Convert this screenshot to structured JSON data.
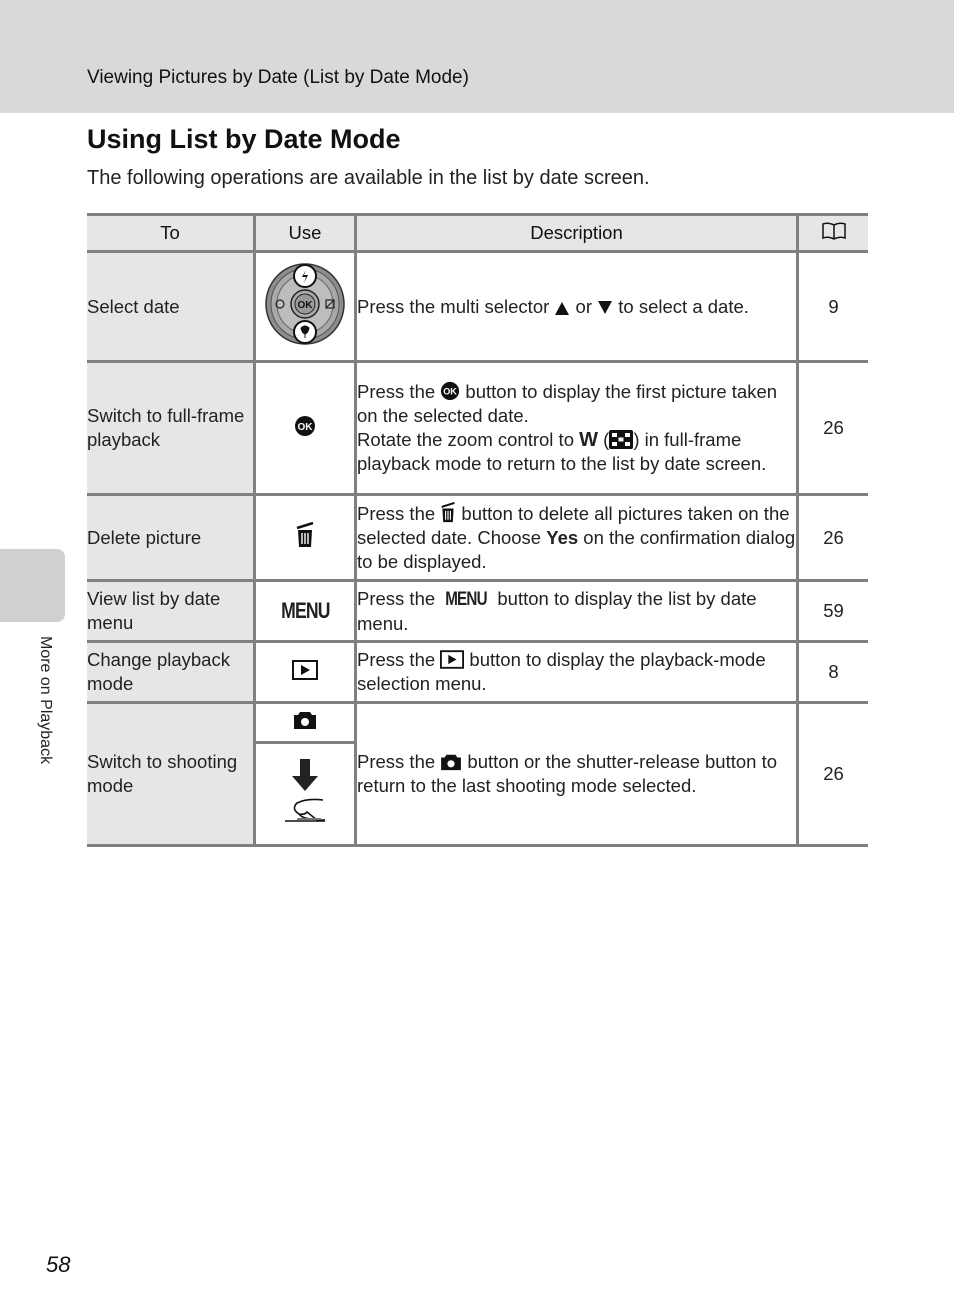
{
  "header": {
    "section_title": "Viewing Pictures by Date (List by Date Mode)"
  },
  "page": {
    "title": "Using List by Date Mode",
    "intro": "The following operations are available in the list by date screen.",
    "side_tab_label": "More on Playback",
    "page_number": "58"
  },
  "table": {
    "headers": {
      "to": "To",
      "use": "Use",
      "description": "Description",
      "reference_icon": "book-icon"
    },
    "rows": [
      {
        "to": "Select date",
        "use_icon": "multi-selector-icon",
        "description_parts": [
          "Press the multi selector ",
          " or ",
          " to select a date."
        ],
        "description_icons": [
          "up-triangle-icon",
          "down-triangle-icon"
        ],
        "ref": "9"
      },
      {
        "to": "Switch to full-frame playback",
        "use_icon": "ok-button-icon",
        "description_parts": [
          "Press the ",
          " button to display the first picture taken on the selected date.",
          "Rotate the zoom control to ",
          " (",
          ") in full-frame playback mode to return to the list by date screen."
        ],
        "description_bold": "W",
        "description_icons": [
          "ok-button-icon",
          "thumbnail-icon"
        ],
        "ref": "26"
      },
      {
        "to": "Delete picture",
        "use_icon": "trash-icon",
        "description_parts": [
          "Press the ",
          " button to delete all pictures taken on the selected date. Choose ",
          " on the confirmation dialog to be displayed."
        ],
        "description_bold": "Yes",
        "description_icons": [
          "trash-icon"
        ],
        "ref": "26"
      },
      {
        "to": "View list by date menu",
        "use_icon": "menu-button-icon",
        "use_text": "MENU",
        "description_parts": [
          "Press the ",
          " button to display the list by date menu."
        ],
        "description_icon_text": "MENU",
        "ref": "59"
      },
      {
        "to": "Change playback mode",
        "use_icon": "playback-button-icon",
        "description_parts": [
          "Press the ",
          " button to display the playback-mode selection menu."
        ],
        "description_icons": [
          "playback-button-icon"
        ],
        "ref": "8"
      },
      {
        "to": "Switch to shooting mode",
        "use_icons": [
          "camera-icon",
          "shutter-release-press-icon"
        ],
        "description_parts": [
          "Press the ",
          " button or the shutter-release button to return to the last shooting mode selected."
        ],
        "description_icons": [
          "camera-icon"
        ],
        "ref": "26"
      }
    ]
  }
}
